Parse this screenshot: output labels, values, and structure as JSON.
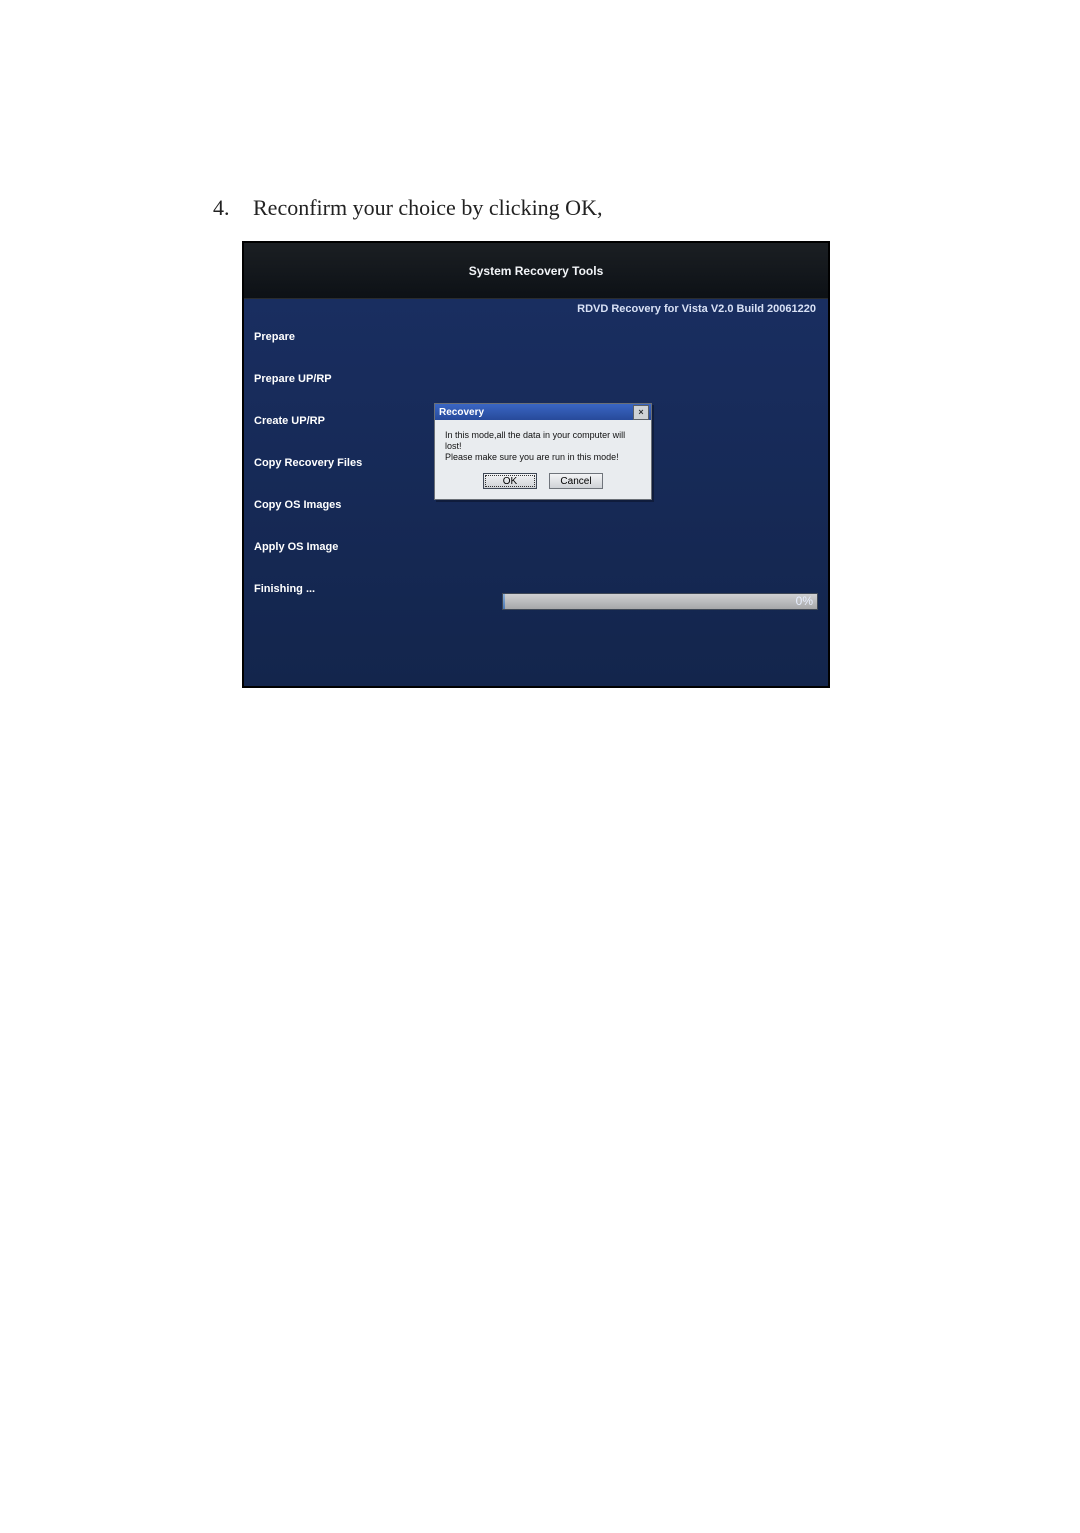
{
  "instruction": {
    "number": "4.",
    "text": "Reconfirm your choice by clicking OK,"
  },
  "app": {
    "title": "System Recovery Tools",
    "subtitle": "RDVD Recovery for Vista V2.0 Build 20061220",
    "steps": [
      "Prepare",
      "Prepare UP/RP",
      "Create UP/RP",
      "Copy Recovery Files",
      "Copy OS Images",
      "Apply OS Image",
      "Finishing ..."
    ],
    "progress_percent": "0%"
  },
  "dialog": {
    "title": "Recovery",
    "message_line1": "In this mode,all the data in your computer will lost!",
    "message_line2": "Please make sure you are run in this mode!",
    "ok": "OK",
    "cancel": "Cancel",
    "close_glyph": "×"
  }
}
